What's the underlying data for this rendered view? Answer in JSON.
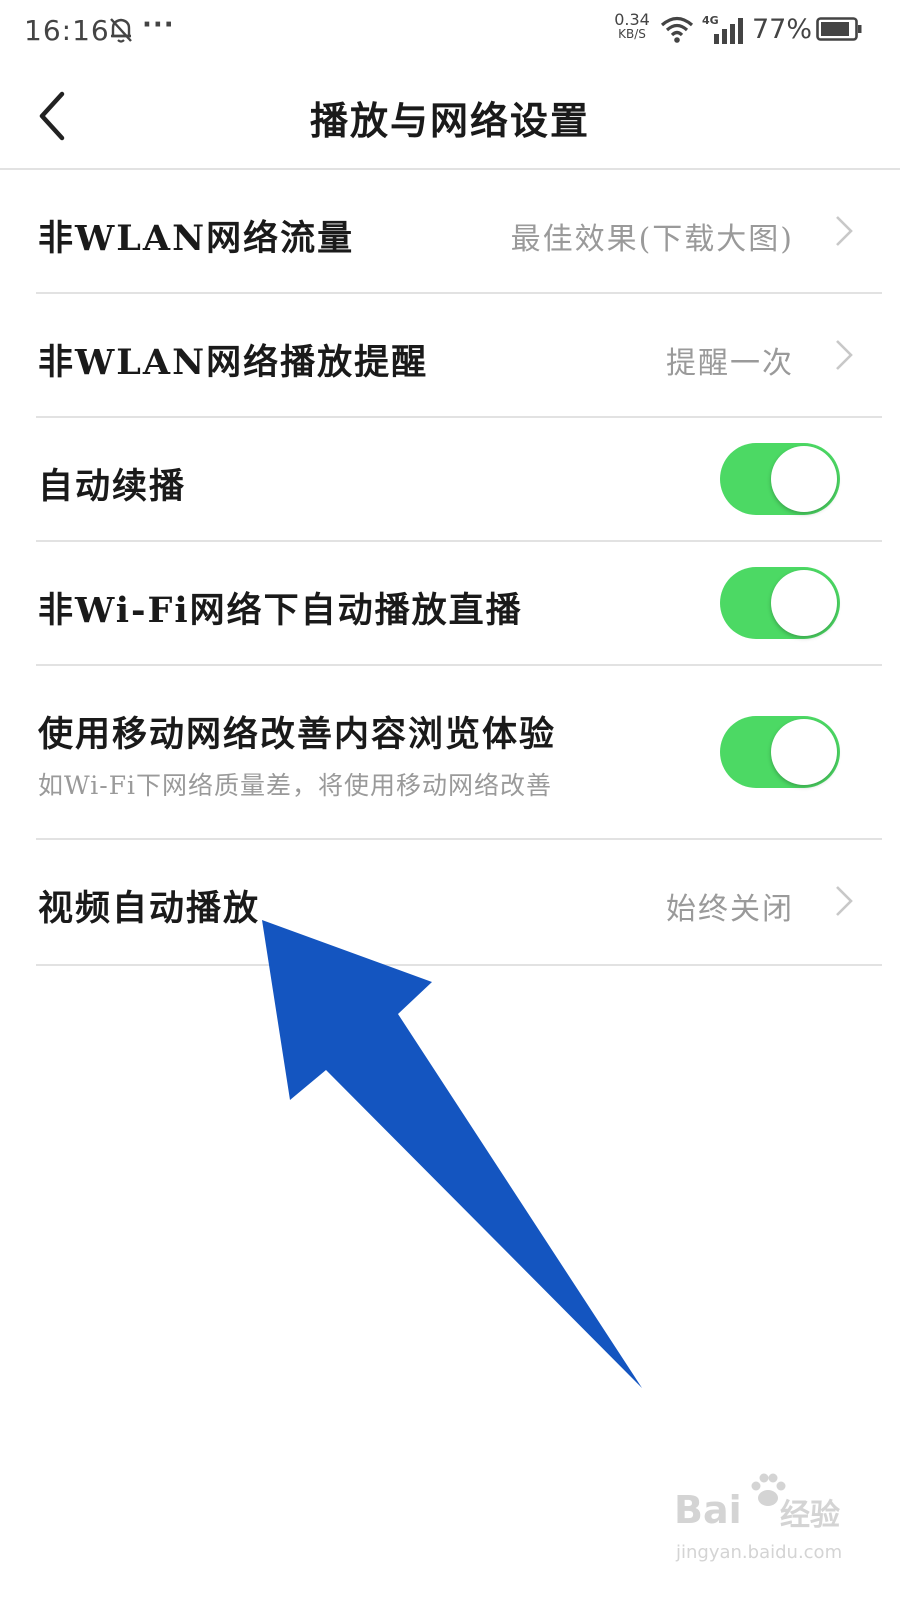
{
  "status_bar": {
    "time": "16:16",
    "more": "···",
    "net_speed_value": "0.34",
    "net_speed_unit": "KB/S",
    "network_type": "4G",
    "battery": "77%"
  },
  "header": {
    "title": "播放与网络设置"
  },
  "settings": [
    {
      "label": "非WLAN网络流量",
      "value": "最佳效果(下载大图)"
    },
    {
      "label": "非WLAN网络播放提醒",
      "value": "提醒一次"
    },
    {
      "label": "自动续播",
      "on": true
    },
    {
      "label": "非Wi-Fi网络下自动播放直播",
      "on": true
    },
    {
      "label": "使用移动网络改善内容浏览体验",
      "sub": "如Wi-Fi下网络质量差，将使用移动网络改善",
      "on": true
    },
    {
      "label": "视频自动播放",
      "value": "始终关闭"
    }
  ],
  "watermark": {
    "brand": "Bai",
    "brand2": "经验",
    "url": "jingyan.baidu.com"
  },
  "colors": {
    "toggle_on": "#4cd964",
    "arrow": "#1455c0",
    "divider": "#e2e2e2"
  }
}
